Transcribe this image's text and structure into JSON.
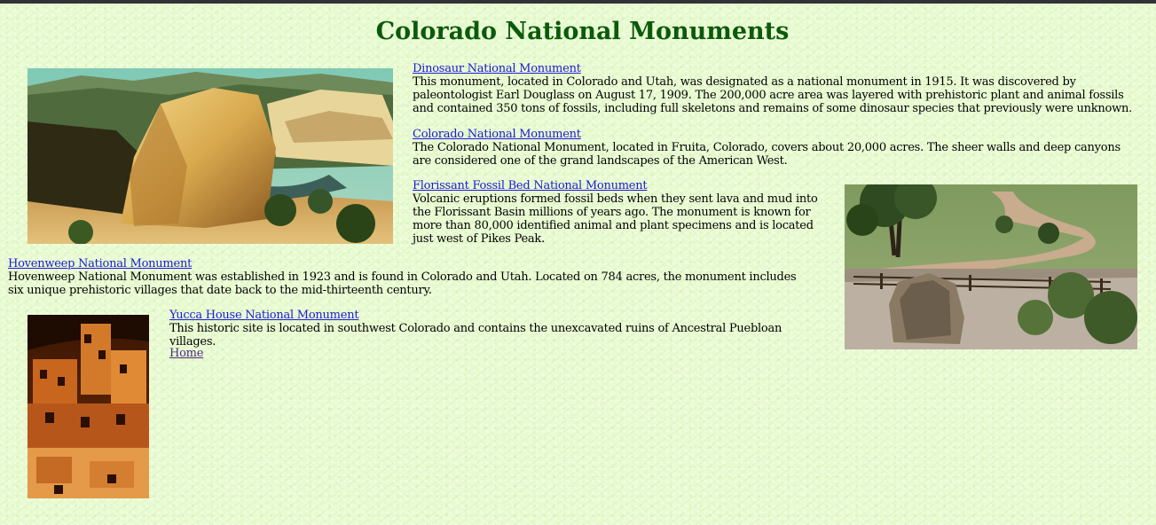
{
  "page_title": "Colorado National Monuments",
  "colors": {
    "background": "#e8fbd0",
    "heading": "#0b5a0b",
    "link": "#1b1bd6",
    "visited_link": "#4b2a80"
  },
  "monuments": [
    {
      "name": "Dinosaur National Monument",
      "description": "This monument, located in Colorado and Utah, was designated as a national monument in 1915. It was discovered by paleontologist Earl Douglass on August 17, 1909. The 200,000 acre area was layered with prehistoric plant and animal fossils and contained 350 tons of fossils, including full skeletons and remains of some dinosaur species that previously were unknown."
    },
    {
      "name": "Colorado National Monument",
      "description": "The Colorado National Monument, located in Fruita, Colorado, covers about 20,000 acres. The sheer walls and deep canyons are considered one of the grand landscapes of the American West."
    },
    {
      "name": "Florissant Fossil Bed National Monument",
      "description": "Volcanic eruptions formed fossil beds when they sent lava and mud into the Florissant Basin millions of years ago. The monument is known for more than 80,000 identified animal and plant specimens and is located just west of Pikes Peak."
    },
    {
      "name": "Hovenweep National Monument",
      "description": "Hovenweep National Monument was established in 1923 and is found in Colorado and Utah. Located on 784 acres, the monument includes six unique prehistoric villages that date back to the mid-thirteenth century."
    },
    {
      "name": "Yucca House National Monument",
      "description": "This historic site is located in southwest Colorado and contains the unexcavated ruins of Ancestral Puebloan villages."
    }
  ],
  "home_link": "Home"
}
